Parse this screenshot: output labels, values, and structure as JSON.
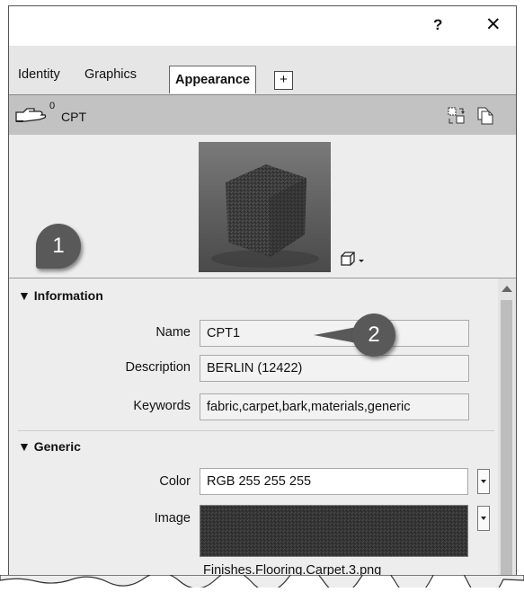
{
  "titlebar": {
    "help": "?",
    "close": "✕"
  },
  "tabs": [
    {
      "label": "Identity",
      "active": false
    },
    {
      "label": "Graphics",
      "active": false
    },
    {
      "label": "Appearance",
      "active": true
    },
    {
      "label": "+",
      "active": false
    }
  ],
  "asset": {
    "usage_count": "0",
    "name": "CPT"
  },
  "sections": {
    "information": {
      "header": "▼ Information",
      "name_label": "Name",
      "name_value": "CPT1",
      "description_label": "Description",
      "description_value": "BERLIN (12422)",
      "keywords_label": "Keywords",
      "keywords_value": "fabric,carpet,bark,materials,generic"
    },
    "generic": {
      "header": "▼ Generic",
      "color_label": "Color",
      "color_value": "RGB 255 255 255",
      "image_label": "Image",
      "image_filename": "Finishes.Flooring.Carpet.3.png"
    }
  },
  "callouts": {
    "one": "1",
    "two": "2"
  },
  "icons": [
    "hand-icon",
    "replace-asset-icon",
    "duplicate-asset-icon",
    "cube-preview-icon",
    "chevron-down-icon",
    "scroll-up-icon"
  ]
}
